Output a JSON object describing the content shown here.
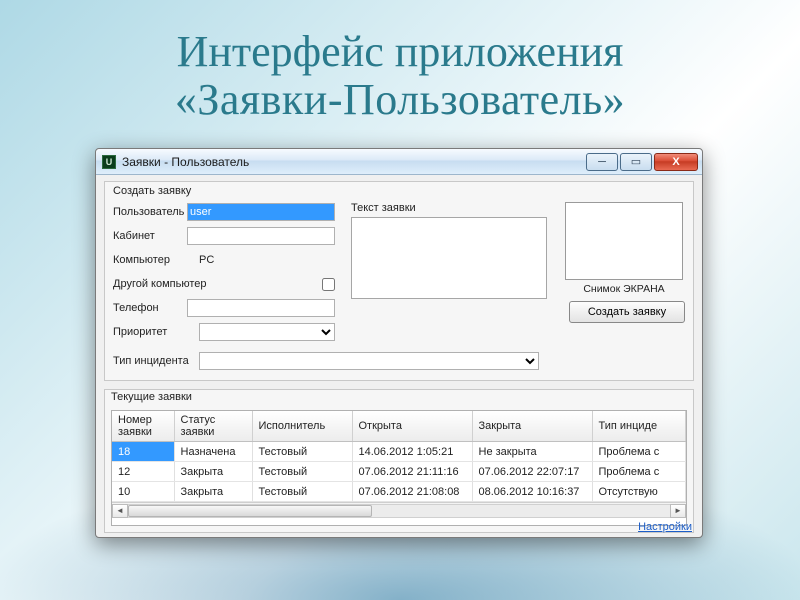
{
  "slide": {
    "title_line1": "Интерфейс приложения",
    "title_line2": "«Заявки-Пользователь»"
  },
  "window": {
    "title": "Заявки - Пользователь",
    "icon_letter": "U",
    "buttons": {
      "min": "─",
      "max": "▭",
      "close": "X"
    }
  },
  "createGroup": {
    "legend": "Создать заявку",
    "user_label": "Пользователь",
    "user_value": "user",
    "room_label": "Кабинет",
    "room_value": "",
    "computer_label": "Компьютер",
    "computer_value": "PC",
    "othercomp_label": "Другой компьютер",
    "phone_label": "Телефон",
    "phone_value": "",
    "priority_label": "Приоритет",
    "priority_value": "",
    "incident_label": "Тип инцидента",
    "incident_value": "",
    "text_label": "Текст заявки",
    "screenshot_label": "Снимок ЭКРАНА",
    "create_button": "Создать заявку"
  },
  "currentGroup": {
    "legend": "Текущие заявки",
    "columns": [
      "Номер заявки",
      "Статус заявки",
      "Исполнитель",
      "Открыта",
      "Закрыта",
      "Тип инциде"
    ],
    "rows": [
      {
        "num": "18",
        "status": "Назначена",
        "exec": "Тестовый",
        "opened": "14.06.2012 1:05:21",
        "closed": "Не закрыта",
        "type": "Проблема с"
      },
      {
        "num": "12",
        "status": "Закрыта",
        "exec": "Тестовый",
        "opened": "07.06.2012 21:11:16",
        "closed": "07.06.2012 22:07:17",
        "type": "Проблема с"
      },
      {
        "num": "10",
        "status": "Закрыта",
        "exec": "Тестовый",
        "opened": "07.06.2012 21:08:08",
        "closed": "08.06.2012 10:16:37",
        "type": "Отсутствую"
      }
    ]
  },
  "footer": {
    "settings": "Настройки"
  }
}
